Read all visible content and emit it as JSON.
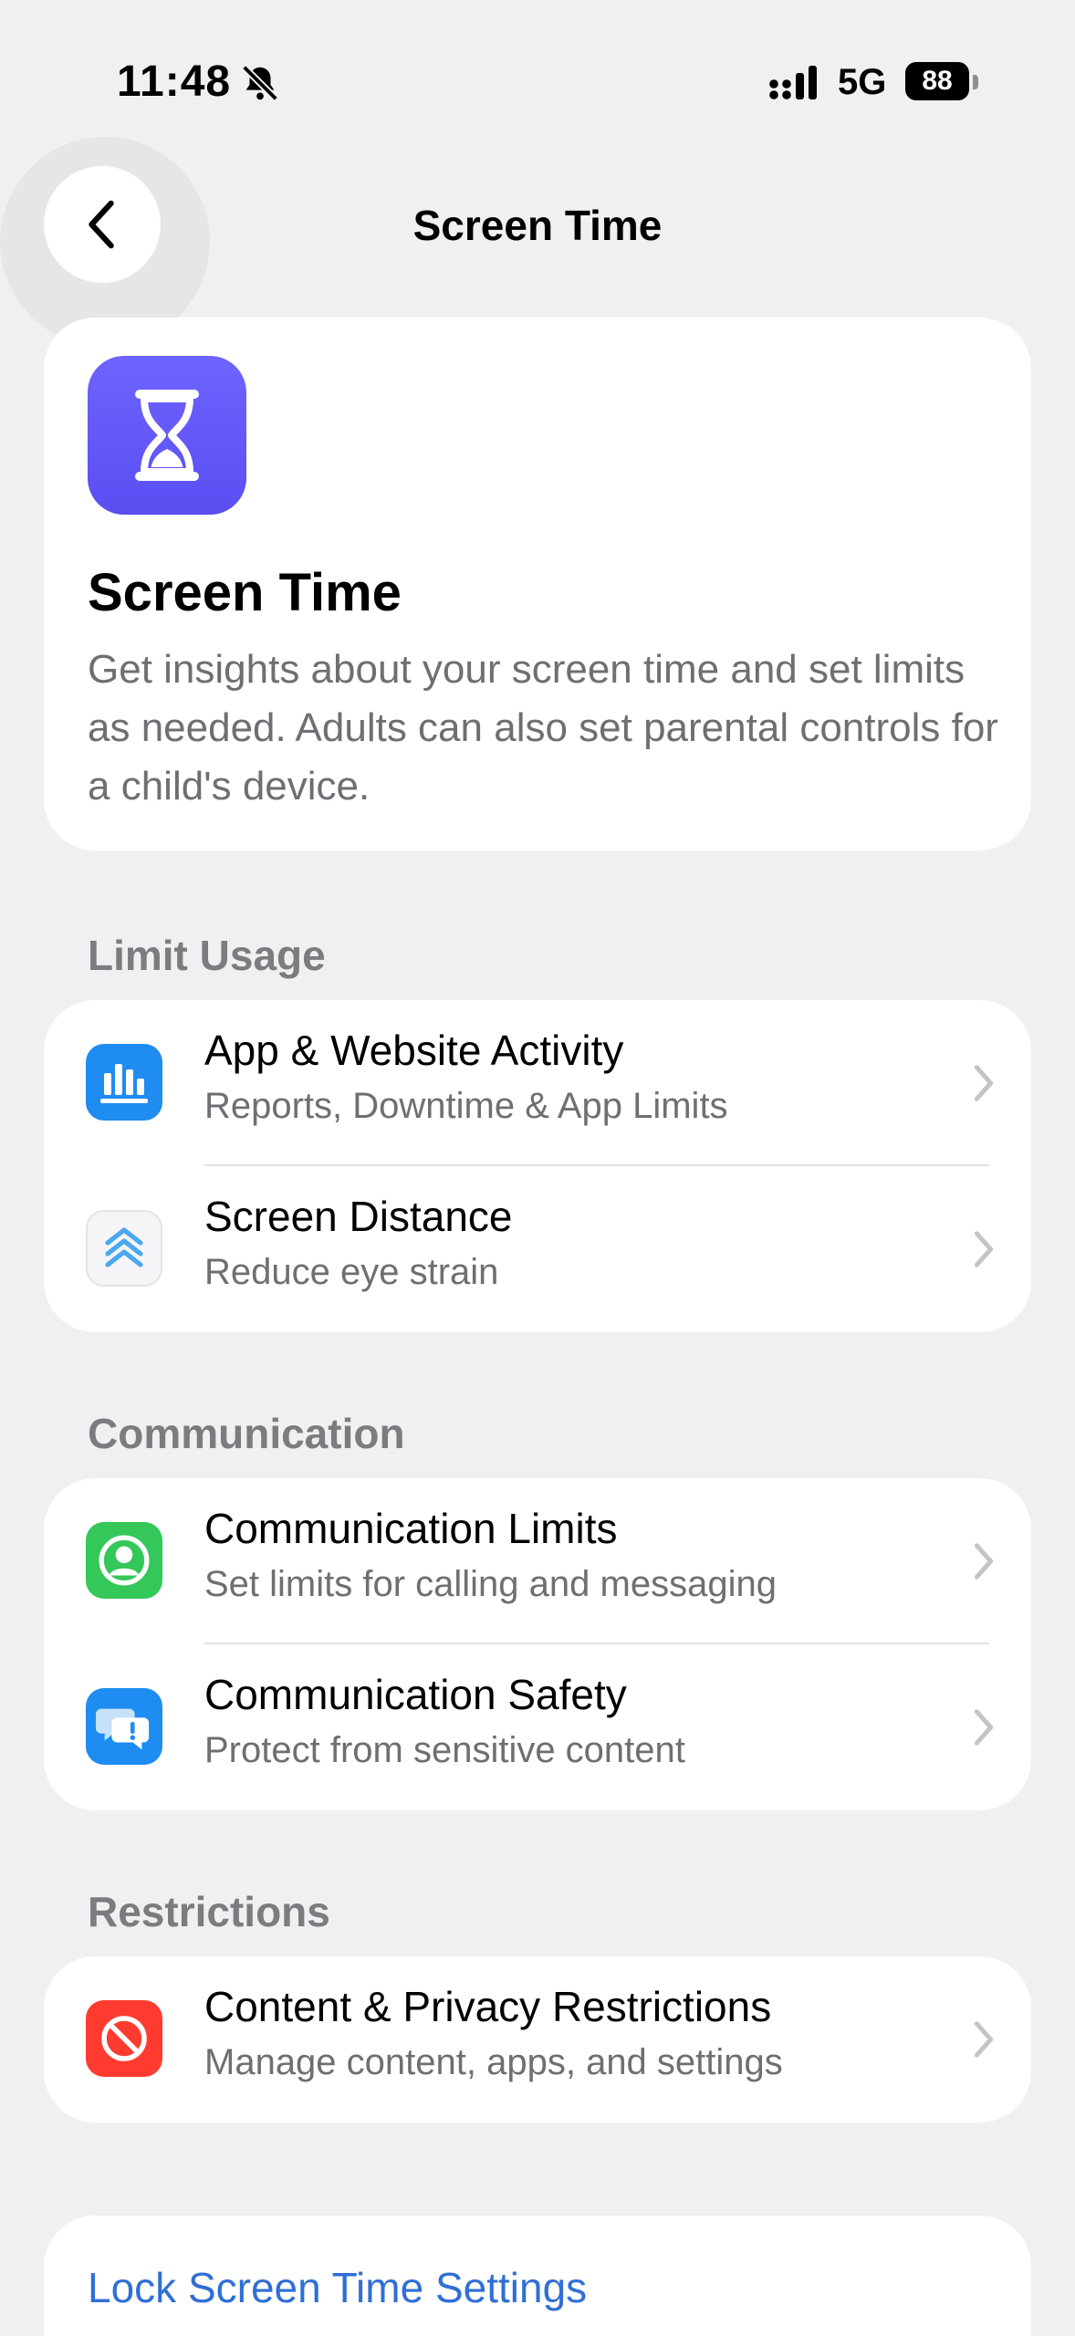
{
  "status_bar": {
    "time": "11:48",
    "network": "5G",
    "battery": "88"
  },
  "nav": {
    "title": "Screen Time"
  },
  "hero": {
    "title": "Screen Time",
    "description": "Get insights about your screen time and set limits as needed. Adults can also set parental controls for a child's device."
  },
  "sections": {
    "limit_usage": {
      "label": "Limit Usage",
      "items": [
        {
          "title": "App & Website Activity",
          "subtitle": "Reports, Downtime & App Limits",
          "icon": "bar-chart-icon",
          "color": "#1e8cf0"
        },
        {
          "title": "Screen Distance",
          "subtitle": "Reduce eye strain",
          "icon": "chevrons-up-icon",
          "color": "#f5f5f7"
        }
      ]
    },
    "communication": {
      "label": "Communication",
      "items": [
        {
          "title": "Communication Limits",
          "subtitle": "Set limits for calling and messaging",
          "icon": "person-circle-icon",
          "color": "#34c759"
        },
        {
          "title": "Communication Safety",
          "subtitle": "Protect from sensitive content",
          "icon": "chat-alert-icon",
          "color": "#1e8cf0"
        }
      ]
    },
    "restrictions": {
      "label": "Restrictions",
      "items": [
        {
          "title": "Content & Privacy Restrictions",
          "subtitle": "Manage content, apps, and settings",
          "icon": "prohibited-icon",
          "color": "#ff3b30"
        }
      ]
    }
  },
  "lock": {
    "label": "Lock Screen Time Settings"
  }
}
